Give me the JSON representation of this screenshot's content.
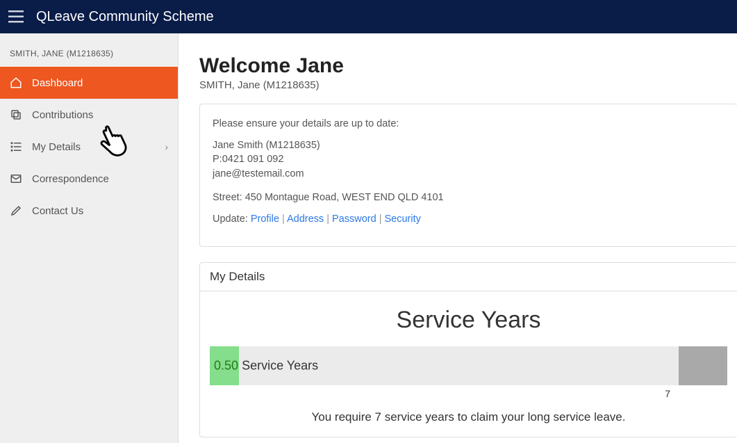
{
  "header": {
    "app_title": "QLeave Community Scheme"
  },
  "sidebar": {
    "user_label": "SMITH, JANE (M1218635)",
    "items": [
      {
        "label": "Dashboard"
      },
      {
        "label": "Contributions"
      },
      {
        "label": "My Details"
      },
      {
        "label": "Correspondence"
      },
      {
        "label": "Contact Us"
      }
    ]
  },
  "main": {
    "welcome_title": "Welcome Jane",
    "welcome_subtitle": "SMITH, Jane (M1218635)",
    "details_card": {
      "intro": "Please ensure your details are up to date:",
      "name_line": "Jane Smith (M1218635)",
      "phone_line": "P:0421 091 092",
      "email_line": "jane@testemail.com",
      "address_line": "Street: 450 Montague Road, WEST END QLD 4101",
      "update_label": "Update:",
      "links": {
        "profile": "Profile",
        "address": "Address",
        "password": "Password",
        "security": "Security"
      }
    },
    "my_details_panel": {
      "header": "My Details",
      "service_title": "Service Years",
      "service_value": "0.50",
      "service_label": "Service Years",
      "target_label": "7",
      "require_text": "You require 7 service years to claim your long service leave."
    }
  },
  "chart_data": {
    "type": "bar",
    "title": "Service Years",
    "categories": [
      "Service Years"
    ],
    "values": [
      0.5
    ],
    "target": 7,
    "xlim": [
      0,
      7
    ],
    "unit": "years"
  }
}
